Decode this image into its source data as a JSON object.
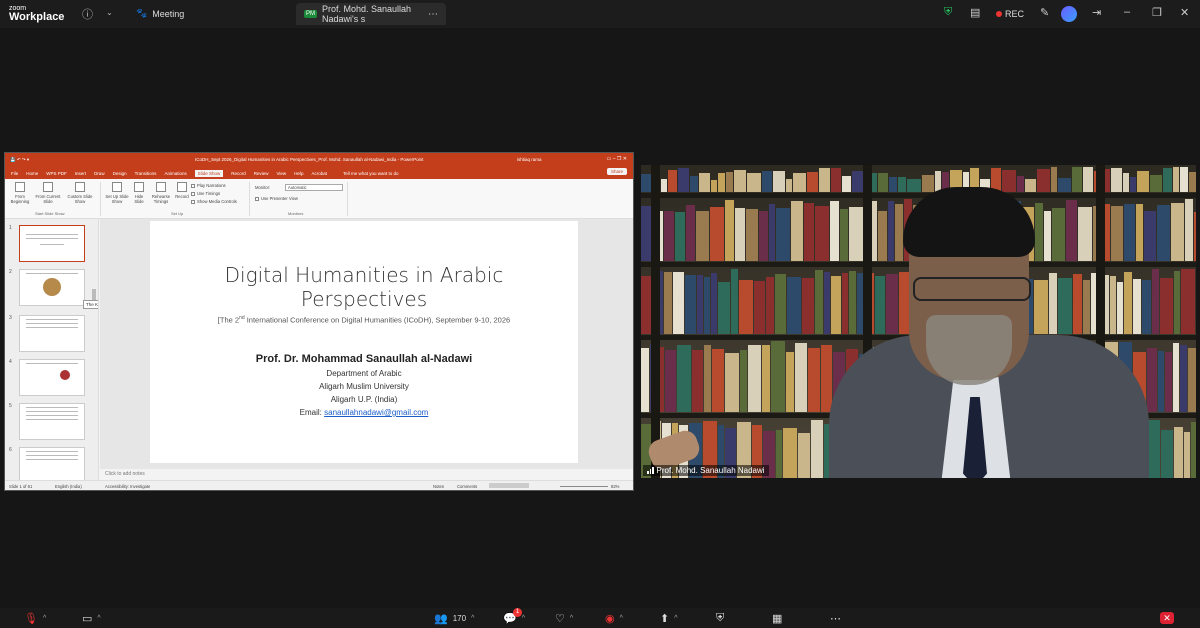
{
  "app": {
    "brand_line1": "zoom",
    "brand_line2": "Workplace"
  },
  "topbar": {
    "meeting_label": "Meeting",
    "share_tab_label": "Prof. Mohd. Sanaullah Nadawi's s",
    "share_badge": "PM",
    "rec_label": "REC",
    "colors": {
      "rec": "#e33333",
      "security": "#22c55e"
    }
  },
  "ppt": {
    "window_title": "ICoDH_Sept 2026_Digital Humanities in Arabic Perspectives_Prof. Mohd. Sanaullah al-Nadawi_India  -  PowerPoint",
    "user": "ishtiaq rama",
    "menu": [
      "File",
      "Home",
      "WPS PDF",
      "Insert",
      "Draw",
      "Design",
      "Transitions",
      "Animations",
      "Slide Show",
      "Record",
      "Review",
      "View",
      "Help",
      "Acrobat"
    ],
    "active_menu": "Slide Show",
    "tell_me": "Tell me what you want to do",
    "share": "Share",
    "ribbon": {
      "from_beginning": "From Beginning",
      "from_current": "From Current Slide",
      "custom_show": "Custom Slide Show",
      "group_start": "Start Slide Show",
      "setup": "Set Up Slide Show",
      "hide": "Hide Slide",
      "rehearse": "Rehearse Timings",
      "record": "Record",
      "group_setup": "Set Up",
      "play_narrations": "Play Narrations",
      "use_timings": "Use Timings",
      "show_media": "Show Media Controls",
      "monitor_label": "Monitor:",
      "monitor_value": "Automatic",
      "presenter_view": "Use Presenter View",
      "group_monitors": "Monitors"
    },
    "thumbs": [
      "1",
      "2",
      "3",
      "4",
      "5",
      "6"
    ],
    "tooltip": "The Kalila wa Dimna Edition Int...",
    "slide": {
      "title_line1": "Digital Humanities in Arabic",
      "title_line2": "Perspectives",
      "subtitle_pre": "[The 2",
      "subtitle_sup": "nd",
      "subtitle_post": " International Conference on Digital Humanities (ICoDH), September 9-10, 2026",
      "author": "Prof. Dr. Mohammad Sanaullah al-Nadawi",
      "dept": "Department of Arabic",
      "univ": "Aligarh Muslim University",
      "city": "Aligarh U.P. (India)",
      "email_label": "Email: ",
      "email": "sanaullahnadawi@gmail.com"
    },
    "notes_placeholder": "Click to add notes",
    "status": {
      "slide_of": "Slide 1 of 61",
      "language": "English (India)",
      "accessibility": "Accessibility: Investigate",
      "notes": "Notes",
      "comments": "Comments",
      "zoom": "82%"
    }
  },
  "video": {
    "participant_name": "Prof. Mohd. Sanaullah Nadawi"
  },
  "bottombar": {
    "participants_count": "170",
    "chat_badge": "1"
  }
}
